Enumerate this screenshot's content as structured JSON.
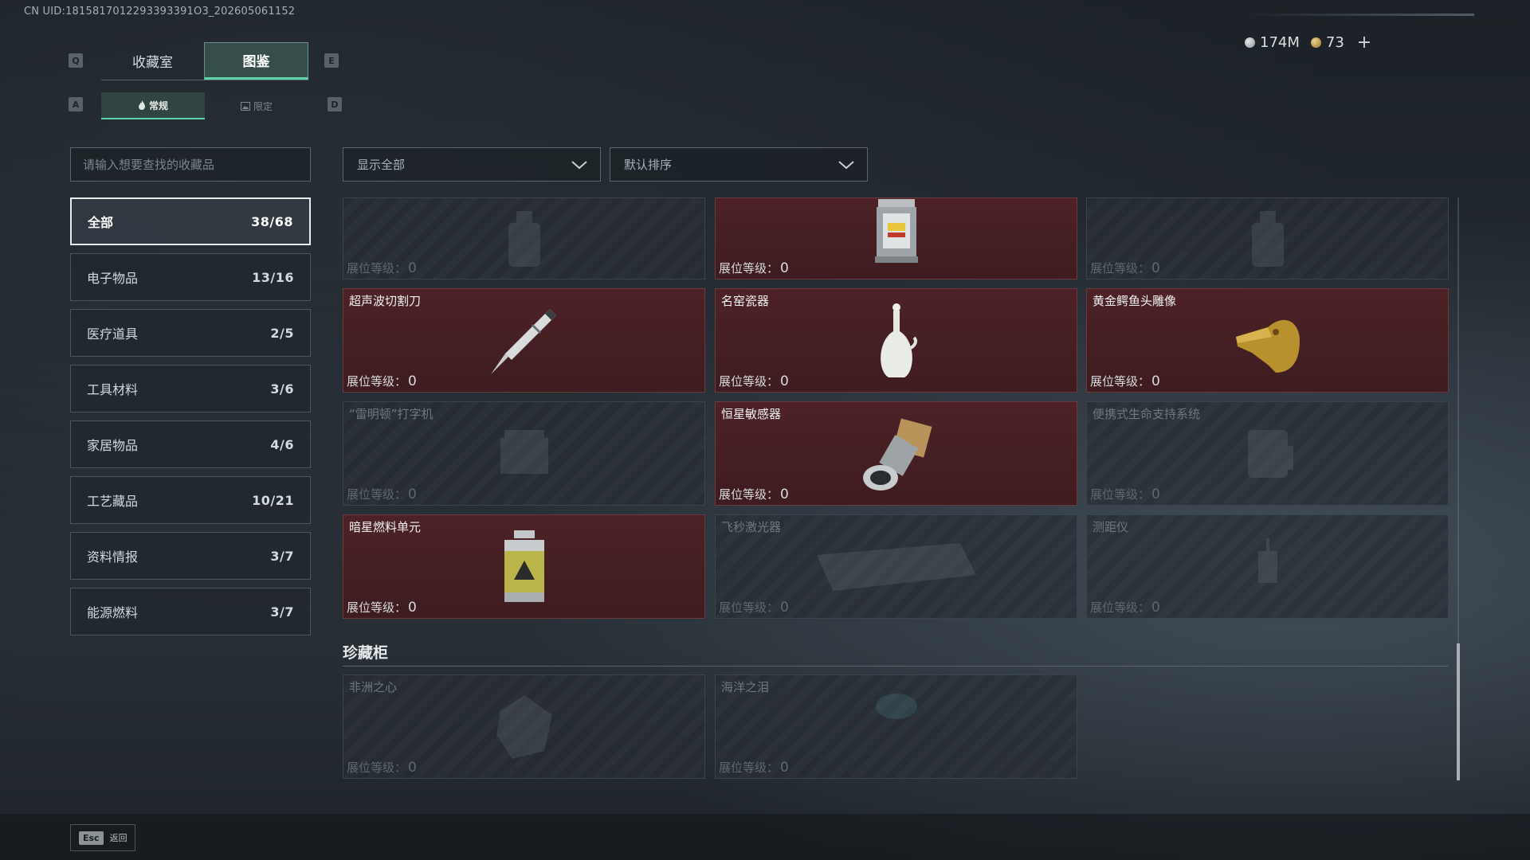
{
  "uid": "CN UID:1815817012293393391O3_202605061152",
  "currency": {
    "silver": "174M",
    "gold": "73",
    "plus": "+"
  },
  "keys": {
    "prev_main": "Q",
    "next_main": "E",
    "prev_sub": "A",
    "next_sub": "D"
  },
  "main_tabs": [
    {
      "label": "收藏室",
      "active": false
    },
    {
      "label": "图鉴",
      "active": true
    }
  ],
  "sub_tabs": [
    {
      "label": "常规",
      "icon": "flame-icon",
      "active": true
    },
    {
      "label": "限定",
      "icon": "image-icon",
      "active": false
    }
  ],
  "search": {
    "placeholder": "请输入想要查找的收藏品",
    "value": ""
  },
  "filter": {
    "selected": "显示全部"
  },
  "sort": {
    "selected": "默认排序"
  },
  "categories": [
    {
      "label": "全部",
      "count": "38/68",
      "active": true
    },
    {
      "label": "电子物品",
      "count": "13/16"
    },
    {
      "label": "医疗道具",
      "count": "2/5"
    },
    {
      "label": "工具材料",
      "count": "3/6"
    },
    {
      "label": "家居物品",
      "count": "4/6"
    },
    {
      "label": "工艺藏品",
      "count": "10/21"
    },
    {
      "label": "资料情报",
      "count": "3/7"
    },
    {
      "label": "能源燃料",
      "count": "3/7"
    }
  ],
  "level_label": "展位等级：",
  "items": [
    {
      "name": "",
      "level": "0",
      "owned": false,
      "icon": "bottle-icon"
    },
    {
      "name": "",
      "level": "0",
      "owned": true,
      "icon": "lantern-icon"
    },
    {
      "name": "",
      "level": "0",
      "owned": false,
      "icon": "bottle-icon"
    },
    {
      "name": "超声波切割刀",
      "level": "0",
      "owned": true,
      "icon": "ultrasonic-cutter-icon"
    },
    {
      "name": "名窑瓷器",
      "level": "0",
      "owned": true,
      "icon": "porcelain-vase-icon"
    },
    {
      "name": "黄金鳄鱼头雕像",
      "level": "0",
      "owned": true,
      "icon": "gold-crocodile-head-icon"
    },
    {
      "name": "“雷明顿”打字机",
      "level": "0",
      "owned": false,
      "icon": "typewriter-icon"
    },
    {
      "name": "恒星敏感器",
      "level": "0",
      "owned": true,
      "icon": "star-sensor-icon"
    },
    {
      "name": "便携式生命支持系统",
      "level": "0",
      "owned": false,
      "icon": "life-support-icon"
    },
    {
      "name": "暗星燃料单元",
      "level": "0",
      "owned": true,
      "icon": "fuel-canister-icon"
    },
    {
      "name": "飞秒激光器",
      "level": "0",
      "owned": false,
      "icon": "laser-icon"
    },
    {
      "name": "测距仪",
      "level": "0",
      "owned": false,
      "icon": "rangefinder-icon"
    }
  ],
  "section": {
    "title": "珍藏柜"
  },
  "treasures": [
    {
      "name": "非洲之心",
      "level": "0",
      "owned": false,
      "icon": "diamond-icon"
    },
    {
      "name": "海洋之泪",
      "level": "0",
      "owned": false,
      "icon": "gem-icon"
    }
  ],
  "footer": {
    "esc_key": "Esc",
    "back_label": "返回"
  }
}
